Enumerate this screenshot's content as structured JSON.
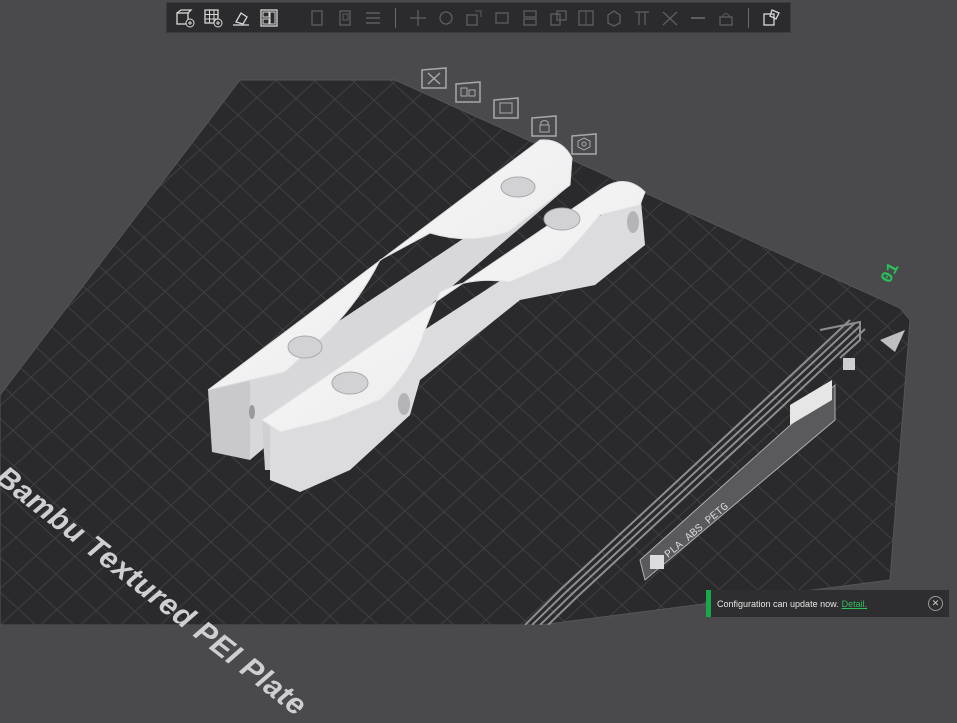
{
  "toolbar": {
    "icons": [
      "add-object-icon",
      "add-plate-icon",
      "auto-orient-icon",
      "arrange-icon",
      "copy-icon",
      "paste-icon",
      "layers-icon",
      "move-icon",
      "rotate-icon",
      "scale-icon",
      "lay-on-face-icon",
      "cut-icon",
      "split-objects-icon",
      "split-parts-icon",
      "variable-layer-icon",
      "support-paint-icon",
      "seam-paint-icon",
      "measure-icon",
      "text-icon",
      "assembly-icon"
    ]
  },
  "plate_toolbar": {
    "icons": [
      "remove-plate-icon",
      "arrange-plate-icon",
      "orient-plate-icon",
      "lock-plate-icon",
      "plate-settings-icon"
    ]
  },
  "plate": {
    "label": "Bambu Textured PEI Plate",
    "number": "01",
    "filament_types": "PLA ABS PETG"
  },
  "notification": {
    "message": "Configuration can update now.",
    "link": "Detail.",
    "close_icon": "close-icon"
  },
  "colors": {
    "background": "#4a4a4d",
    "plate": "#2a2a2c",
    "grid": "#3f3f42",
    "model": "#f2f2f2",
    "accent_green": "#19a84c",
    "notification_bg": "#2e2e30"
  }
}
